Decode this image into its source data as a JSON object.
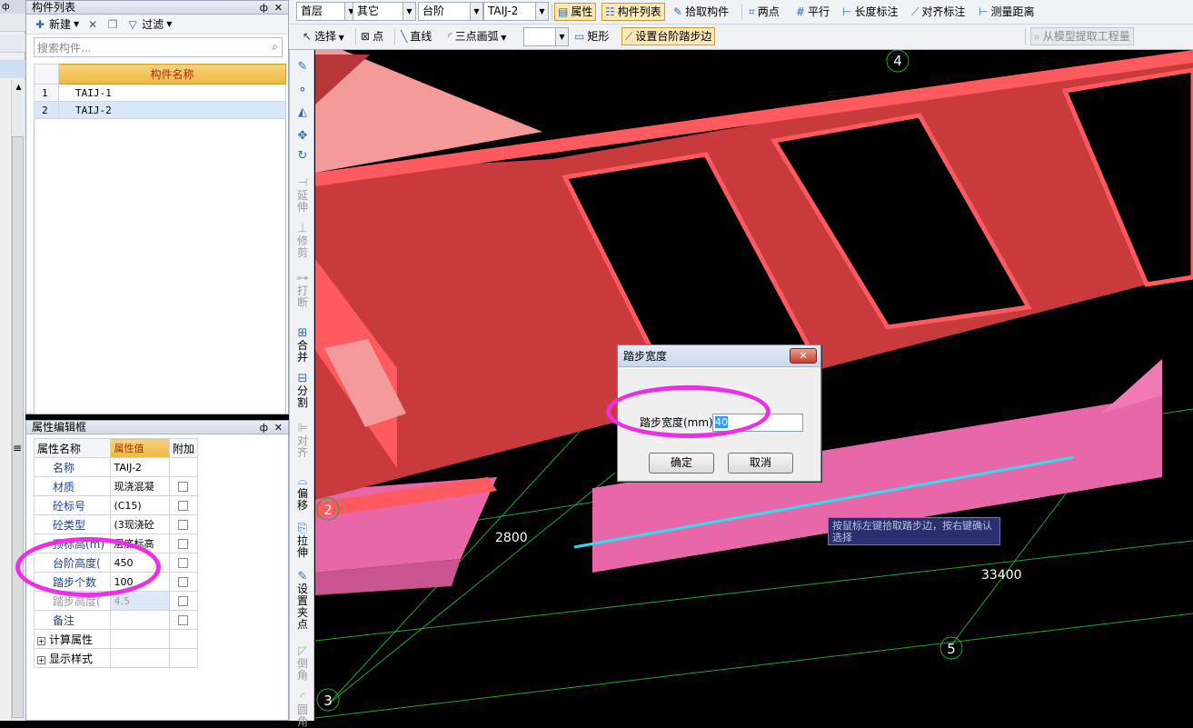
{
  "left_strip": {
    "pin": "ф",
    "close": "✕",
    "menu_glyph": "≡"
  },
  "component_list": {
    "title": "构件列表",
    "toolbar": {
      "new_label": "新建",
      "filter_label": "过滤"
    },
    "search_placeholder": "搜索构件...",
    "column_header": "构件名称",
    "rows": [
      {
        "num": "1",
        "name": "TAIJ-1"
      },
      {
        "num": "2",
        "name": "TAIJ-2"
      }
    ]
  },
  "property_editor": {
    "title": "属性编辑框",
    "headers": {
      "name": "属性名称",
      "value": "属性值",
      "extra": "附加"
    },
    "rows": [
      {
        "key": "名称",
        "value": "TAIJ-2"
      },
      {
        "key": "材质",
        "value": "现浇混凝"
      },
      {
        "key": "砼标号",
        "value": "(C15)"
      },
      {
        "key": "砼类型",
        "value": "(3现浇砼"
      },
      {
        "key": "顶标高(m)",
        "value": "层底标高"
      },
      {
        "key": "台阶高度(",
        "value": "450"
      },
      {
        "key": "踏步个数",
        "value": "100"
      },
      {
        "key": "踏步高度(",
        "value": "4.5"
      },
      {
        "key": "备注",
        "value": ""
      }
    ],
    "groups": [
      "计算属性",
      "显示样式"
    ]
  },
  "toolbar1": {
    "floor": "首层",
    "category": "其它",
    "type": "台阶",
    "component": "TAIJ-2",
    "items": [
      "属性",
      "构件列表",
      "拾取构件",
      "两点",
      "平行",
      "长度标注",
      "对齐标注",
      "测量距离"
    ]
  },
  "toolbar2": {
    "select": "选择",
    "point": "点",
    "line": "直线",
    "arc": "三点画弧",
    "rect": "矩形",
    "set_step": "设置台阶踏步边",
    "extract": "从模型提取工程量"
  },
  "vertical_toolbar": [
    "延伸",
    "修剪",
    "打断",
    "合并",
    "分割",
    "对齐",
    "偏移",
    "拉伸",
    "设置夹点",
    "倒角",
    "圆角"
  ],
  "canvas": {
    "grid_labels": [
      "4",
      "2",
      "3",
      "5"
    ],
    "dimensions": [
      "2800",
      "33400"
    ],
    "colors": {
      "slab": "#c83a3c",
      "slab_edge": "#ff5a5f",
      "step": "#f07ab4",
      "grid": "#1ea83a",
      "pick_line": "#33ddee"
    }
  },
  "dialog": {
    "title": "踏步宽度",
    "label": "踏步宽度(mm):",
    "value": "40",
    "ok": "确定",
    "cancel": "取消",
    "close": "✕"
  },
  "tooltip": {
    "text": "按鼠标左键拾取踏步边，按右键确认选择"
  }
}
